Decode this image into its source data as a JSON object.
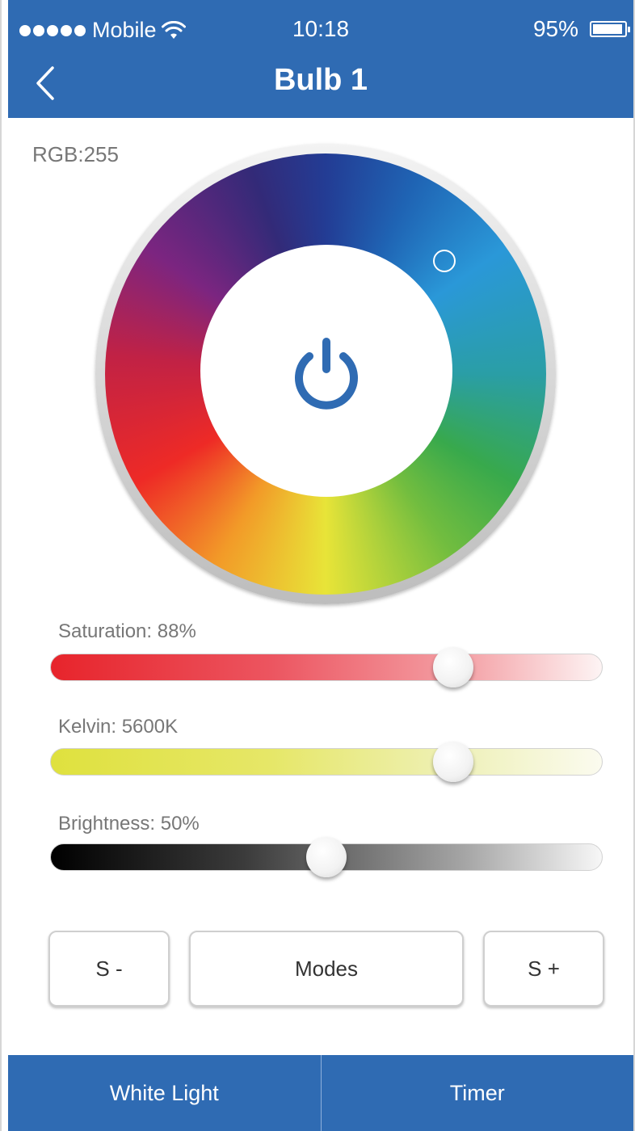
{
  "status": {
    "carrier": "Mobile",
    "time": "10:18",
    "battery": "95%",
    "battery_level": 0.95,
    "signal_dots": 5
  },
  "header": {
    "title": "Bulb 1",
    "back_icon": "chevron-left-icon"
  },
  "color": {
    "rgb_label": "RGB:255",
    "power_icon": "power-icon",
    "accent": "#2f6bb3"
  },
  "sliders": {
    "saturation": {
      "label": "Saturation: 88%",
      "value": 0.73
    },
    "kelvin": {
      "label": "Kelvin: 5600K",
      "value": 0.73
    },
    "brightness": {
      "label": "Brightness: 50%",
      "value": 0.5
    }
  },
  "buttons": {
    "speed_down": "S -",
    "modes": "Modes",
    "speed_up": "S +"
  },
  "bottom_tabs": {
    "white_light": "White Light",
    "timer": "Timer"
  }
}
